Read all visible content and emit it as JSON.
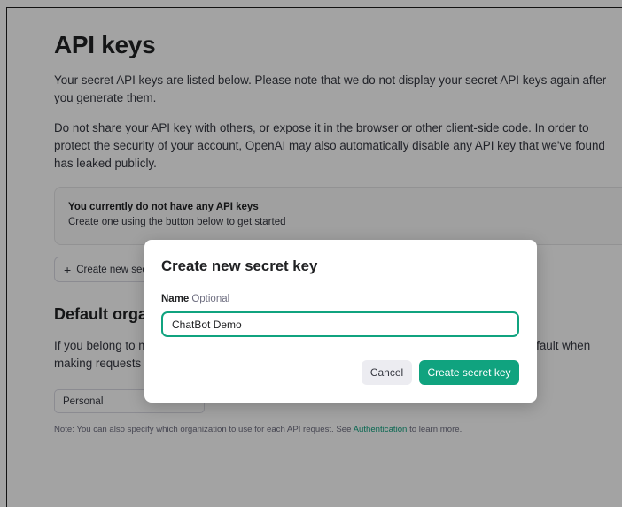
{
  "page": {
    "title": "API keys",
    "intro_1": "Your secret API keys are listed below. Please note that we do not display your secret API keys again after you generate them.",
    "intro_2": "Do not share your API key with others, or expose it in the browser or other client-side code. In order to protect the security of your account, OpenAI may also automatically disable any API key that we've found has leaked publicly.",
    "empty_state": {
      "title": "You currently do not have any API keys",
      "subtitle": "Create one using the button below to get started"
    },
    "create_button": "Create new secret key",
    "default_org": {
      "title": "Default organization",
      "description": "If you belong to multiple organizations, this setting controls which organization is used by default when making requests with the API keys above.",
      "selected": "Personal",
      "note_prefix": "Note: You can also specify which organization to use for each API request. See ",
      "note_link": "Authentication",
      "note_suffix": " to learn more."
    }
  },
  "modal": {
    "title": "Create new secret key",
    "name_label": "Name",
    "name_optional": "Optional",
    "name_value": "ChatBot Demo",
    "cancel_label": "Cancel",
    "submit_label": "Create secret key"
  },
  "colors": {
    "accent": "#10a37f",
    "overlay": "rgba(0,0,0,0.36)"
  },
  "icons": {
    "create_button_icon": "plus-icon"
  }
}
